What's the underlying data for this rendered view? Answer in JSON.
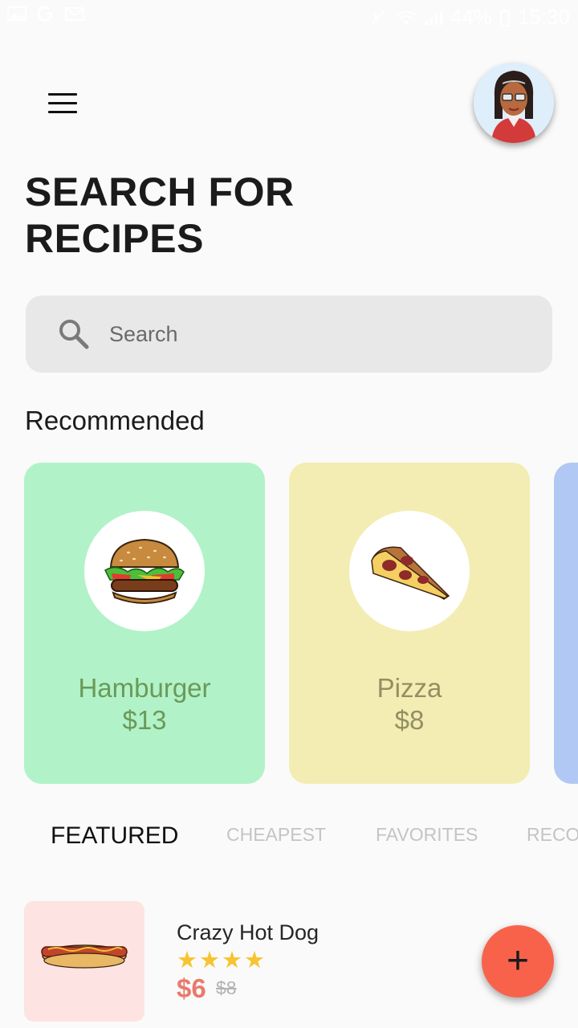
{
  "status_bar": {
    "battery": "44%",
    "time": "15:30",
    "icons": [
      "image-icon",
      "google-icon",
      "gmail-icon",
      "mute-icon",
      "wifi-icon",
      "signal-icon",
      "battery-icon"
    ]
  },
  "header": {
    "menu_icon": "hamburger-menu-icon",
    "avatar": "user-avatar"
  },
  "page_title_line1": "SEARCH FOR",
  "page_title_line2": "RECIPES",
  "search": {
    "placeholder": "Search",
    "icon": "search-icon"
  },
  "recommended": {
    "title": "Recommended",
    "items": [
      {
        "name": "Hamburger",
        "price": "$13",
        "bg": "#b2f2c8",
        "text_color": "#6a9a59"
      },
      {
        "name": "Pizza",
        "price": "$8",
        "bg": "#f3edb4",
        "text_color": "#938f62"
      },
      {
        "bg": "#b2c8f4"
      }
    ]
  },
  "tabs": [
    {
      "label": "FEATURED",
      "active": true
    },
    {
      "label": "CHEAPEST",
      "active": false
    },
    {
      "label": "FAVORITES",
      "active": false
    },
    {
      "label": "RECO",
      "active": false
    }
  ],
  "featured": [
    {
      "name": "Crazy Hot Dog",
      "rating": 4,
      "stars": "★★★★",
      "price": "$6",
      "old_price": "$8"
    }
  ],
  "fab": {
    "label": "+"
  },
  "colors": {
    "accent": "#f8624b",
    "star": "#f7c431"
  }
}
